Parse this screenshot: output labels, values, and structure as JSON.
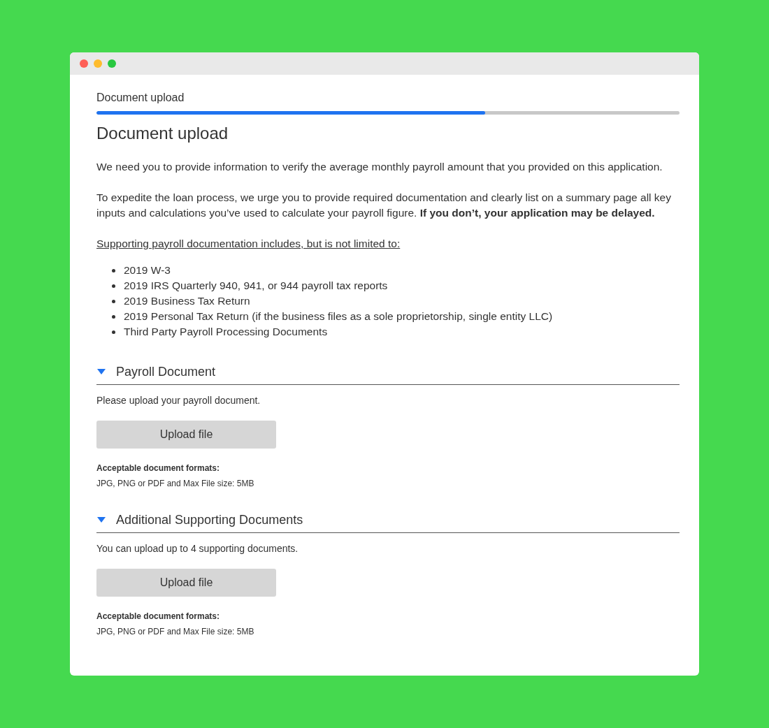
{
  "progress": {
    "label": "Document upload",
    "level": 0.667
  },
  "heading": "Document upload",
  "paragraphs": [
    "We need you to provide information to verify the average monthly payroll amount that you provided on this application.",
    "To expedite the loan process, we urge you to provide required documentation and clearly list on a summary page all key inputs and calculations you’ve used to calculate your payroll figure. **If you don’t, your application may be delayed.**"
  ],
  "list_intro": "Supporting payroll documentation includes, but is not limited to:",
  "list_items": [
    "2019 W-3",
    "2019 IRS Quarterly 940, 941, or 944 payroll tax reports",
    "2019 Business Tax Return",
    "2019 Personal Tax Return (if the business files as a sole proprietorship, single entity LLC)",
    "Third Party Payroll Processing Documents"
  ],
  "sections": [
    {
      "title": "Payroll Document",
      "expanded": true,
      "instruction": "Please upload your payroll document.",
      "button": "Upload file",
      "formats_label": "Acceptable document formats:",
      "formats": "JPG, PNG or PDF and Max File size: 5MB"
    },
    {
      "title": "Additional Supporting Documents",
      "expanded": true,
      "instruction": "You can upload up to 4 supporting documents.",
      "button": "Upload file",
      "formats_label": "Acceptable document formats:",
      "formats": "JPG, PNG or PDF and Max File size: 5MB"
    }
  ]
}
